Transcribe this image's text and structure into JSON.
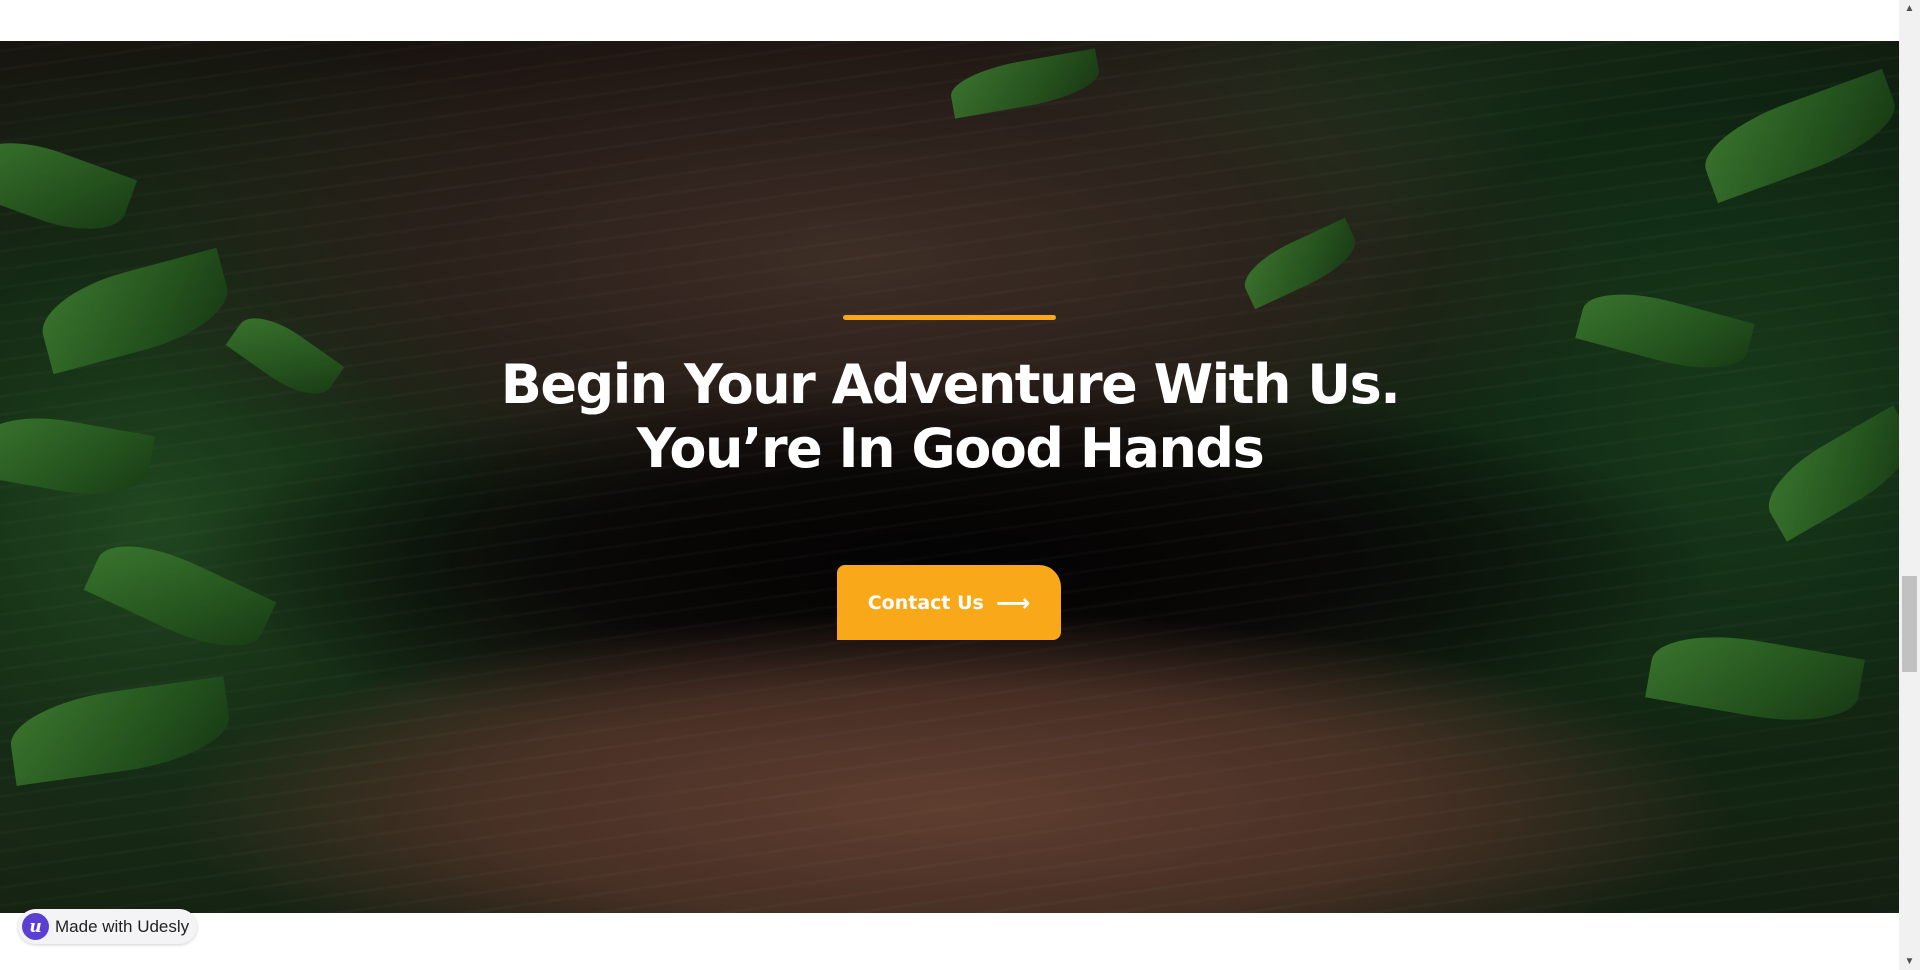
{
  "hero": {
    "accent_color": "#f9a81a",
    "headline_line1": "Begin Your Adventure With Us.",
    "headline_line2": "You’re In Good Hands",
    "cta_label": "Contact Us",
    "cta_icon": "arrow-right-icon",
    "cta_arrow_glyph": "⟶"
  },
  "badge": {
    "logo_letter": "u",
    "label": "Made with Udesly",
    "brand_color": "#5b3fd3"
  },
  "scrollbar": {
    "up_glyph": "▲",
    "down_glyph": "▼"
  }
}
